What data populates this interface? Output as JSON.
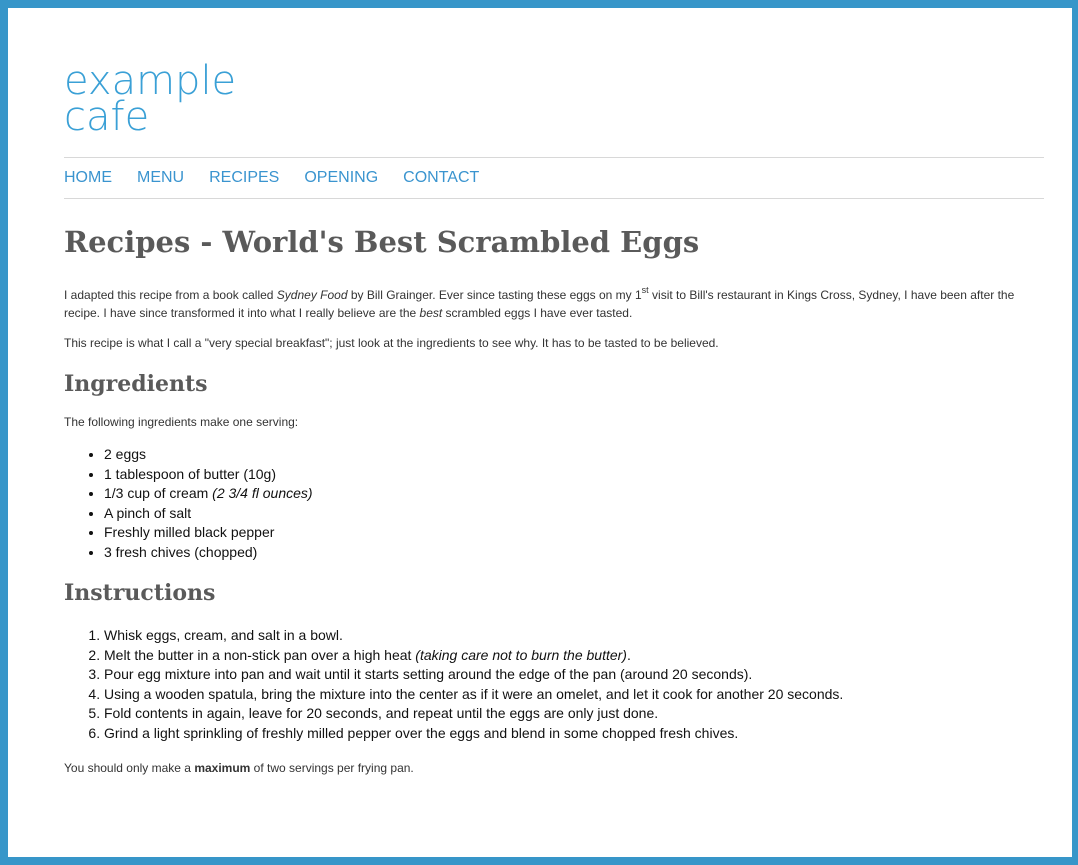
{
  "logo": {
    "line1": "example",
    "line2": "cafe"
  },
  "nav": [
    "HOME",
    "MENU",
    "RECIPES",
    "OPENING",
    "CONTACT"
  ],
  "page_title": "Recipes - World's Best Scrambled Eggs",
  "intro": {
    "p1_a": "I adapted this recipe from a book called ",
    "p1_book": "Sydney Food",
    "p1_b": " by Bill Grainger. Ever since tasting these eggs on my 1",
    "p1_sup": "st",
    "p1_c": " visit to Bill's restaurant in Kings Cross, Sydney, I have been after the recipe. I have since transformed it into what I really believe are the ",
    "p1_best": "best",
    "p1_d": " scrambled eggs I have ever tasted.",
    "p2": "This recipe is what I call a \"very special breakfast\"; just look at the ingredients to see why. It has to be tasted to be believed."
  },
  "ingredients": {
    "heading": "Ingredients",
    "lead": "The following ingredients make one serving:",
    "items": [
      "2 eggs",
      "1 tablespoon of butter (10g)",
      "1/3 cup of cream ",
      "A pinch of salt",
      "Freshly milled black pepper",
      "3 fresh chives (chopped)"
    ],
    "cream_note": "(2 3/4 fl ounces)"
  },
  "instructions": {
    "heading": "Instructions",
    "steps": [
      "Whisk eggs, cream, and salt in a bowl.",
      "Melt the butter in a non-stick pan over a high heat ",
      "Pour egg mixture into pan and wait until it starts setting around the edge of the pan (around 20 seconds).",
      "Using a wooden spatula, bring the mixture into the center as if it were an omelet, and let it cook for another 20 seconds.",
      "Fold contents in again, leave for 20 seconds, and repeat until the eggs are only just done.",
      "Grind a light sprinkling of freshly milled pepper over the eggs and blend in some chopped fresh chives."
    ],
    "step2_note": "(taking care not to burn the butter)",
    "step2_end": "."
  },
  "footer_note": {
    "a": "You should only make a ",
    "b": "maximum",
    "c": " of two servings per frying pan."
  },
  "colors": {
    "frame": "#3796c9",
    "logo": "#3aa0d6",
    "link": "#3a94cf",
    "heading": "#5a5a5a"
  }
}
